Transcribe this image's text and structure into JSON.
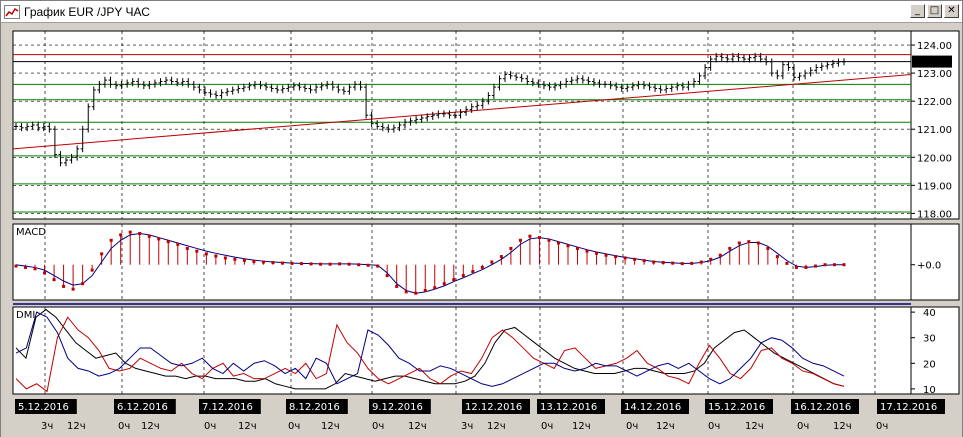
{
  "window": {
    "title": "График EUR /JPY  ЧАС",
    "buttons": [
      "_",
      "□",
      "✕"
    ]
  },
  "chart_data": [
    {
      "panel": "price",
      "type": "bar",
      "symbol": "EUR/JPY",
      "timeframe": "ЧАС",
      "current_price": "123.41",
      "y_ticks": [
        "124.00",
        "123.00",
        "122.00",
        "121.00",
        "120.00",
        "119.00",
        "118.00"
      ],
      "y_values": [
        124,
        123,
        122,
        121,
        120,
        119,
        118
      ],
      "ylim": [
        117.8,
        124.5
      ],
      "horizontal_levels": [
        {
          "value": 123.66,
          "color": "#c00000"
        },
        {
          "value": 123.41,
          "color": "#000000"
        },
        {
          "value": 122.6,
          "color": "#008000"
        },
        {
          "value": 122.05,
          "color": "#008000"
        },
        {
          "value": 121.25,
          "color": "#008000"
        },
        {
          "value": 120.05,
          "color": "#008000"
        },
        {
          "value": 119.05,
          "color": "#008000"
        },
        {
          "value": 118.05,
          "color": "#008000"
        }
      ],
      "trendline": {
        "from": [
          0,
          120.3
        ],
        "to": [
          1,
          122.95
        ],
        "color": "#c00000"
      },
      "closes": [
        121.1,
        121.05,
        121.1,
        121.15,
        121.05,
        121.1,
        121.0,
        120.1,
        119.8,
        119.9,
        120.0,
        120.3,
        121.0,
        121.8,
        122.4,
        122.6,
        122.75,
        122.6,
        122.55,
        122.6,
        122.65,
        122.7,
        122.6,
        122.55,
        122.6,
        122.65,
        122.7,
        122.75,
        122.7,
        122.65,
        122.7,
        122.6,
        122.5,
        122.4,
        122.3,
        122.25,
        122.2,
        122.3,
        122.35,
        122.4,
        122.45,
        122.5,
        122.55,
        122.6,
        122.55,
        122.5,
        122.45,
        122.4,
        122.45,
        122.5,
        122.55,
        122.5,
        122.45,
        122.4,
        122.5,
        122.55,
        122.6,
        122.5,
        122.4,
        122.35,
        122.5,
        122.6,
        122.5,
        121.5,
        121.2,
        121.1,
        121.05,
        121.0,
        121.05,
        121.15,
        121.25,
        121.3,
        121.35,
        121.4,
        121.45,
        121.5,
        121.55,
        121.55,
        121.5,
        121.5,
        121.6,
        121.7,
        121.8,
        121.85,
        122.0,
        122.2,
        122.5,
        122.8,
        122.95,
        122.9,
        122.85,
        122.8,
        122.7,
        122.65,
        122.6,
        122.55,
        122.5,
        122.55,
        122.6,
        122.7,
        122.75,
        122.8,
        122.75,
        122.7,
        122.65,
        122.6,
        122.6,
        122.55,
        122.5,
        122.45,
        122.5,
        122.55,
        122.6,
        122.55,
        122.5,
        122.45,
        122.4,
        122.45,
        122.5,
        122.55,
        122.5,
        122.6,
        122.7,
        122.9,
        123.2,
        123.5,
        123.6,
        123.55,
        123.5,
        123.6,
        123.55,
        123.5,
        123.55,
        123.6,
        123.5,
        123.4,
        123.0,
        122.9,
        123.3,
        123.2,
        122.85,
        122.9,
        123.0,
        123.1,
        123.2,
        123.25,
        123.3,
        123.35,
        123.4,
        123.41
      ]
    },
    {
      "panel": "MACD",
      "type": "line",
      "label": "MACD",
      "y_tick": "+0.0",
      "series": [
        {
          "name": "MACD",
          "color": "#c00000",
          "style": "histogram+dots"
        },
        {
          "name": "signal",
          "color": "#000080",
          "style": "line"
        }
      ],
      "macd": [
        -0.05,
        -0.1,
        -0.15,
        -0.3,
        -0.55,
        -0.8,
        -0.9,
        -0.7,
        -0.2,
        0.4,
        0.9,
        1.1,
        1.2,
        1.15,
        1.05,
        0.95,
        0.85,
        0.75,
        0.6,
        0.5,
        0.4,
        0.32,
        0.25,
        0.2,
        0.16,
        0.12,
        0.1,
        0.08,
        0.06,
        0.05,
        0.04,
        0.03,
        0.02,
        0.02,
        0.03,
        0.02,
        0.0,
        -0.02,
        -0.05,
        -0.4,
        -0.8,
        -1.0,
        -1.05,
        -0.95,
        -0.85,
        -0.7,
        -0.55,
        -0.4,
        -0.25,
        -0.1,
        0.1,
        0.3,
        0.6,
        0.9,
        1.05,
        1.0,
        0.9,
        0.8,
        0.7,
        0.6,
        0.5,
        0.42,
        0.35,
        0.3,
        0.25,
        0.2,
        0.15,
        0.1,
        0.08,
        0.06,
        0.04,
        0.05,
        0.1,
        0.2,
        0.35,
        0.6,
        0.8,
        0.85,
        0.8,
        0.6,
        0.3,
        0.05,
        -0.1,
        -0.1,
        -0.05,
        0.0,
        0.0,
        0.0
      ],
      "signal": [
        0.0,
        -0.05,
        -0.1,
        -0.2,
        -0.4,
        -0.6,
        -0.75,
        -0.7,
        -0.4,
        0.1,
        0.6,
        0.9,
        1.1,
        1.15,
        1.1,
        1.0,
        0.9,
        0.8,
        0.7,
        0.6,
        0.5,
        0.42,
        0.35,
        0.28,
        0.22,
        0.17,
        0.13,
        0.1,
        0.08,
        0.06,
        0.05,
        0.04,
        0.03,
        0.03,
        0.03,
        0.03,
        0.02,
        0.0,
        -0.02,
        -0.3,
        -0.7,
        -0.95,
        -1.05,
        -1.0,
        -0.9,
        -0.78,
        -0.62,
        -0.48,
        -0.33,
        -0.18,
        0.0,
        0.2,
        0.45,
        0.75,
        0.95,
        1.0,
        0.95,
        0.85,
        0.75,
        0.65,
        0.55,
        0.47,
        0.4,
        0.33,
        0.27,
        0.22,
        0.17,
        0.12,
        0.09,
        0.07,
        0.05,
        0.05,
        0.08,
        0.15,
        0.28,
        0.5,
        0.7,
        0.82,
        0.82,
        0.68,
        0.42,
        0.15,
        -0.05,
        -0.1,
        -0.07,
        -0.02,
        0.0,
        0.0
      ],
      "ylim": [
        -1.3,
        1.5
      ]
    },
    {
      "panel": "DMI",
      "type": "line",
      "label": "DMI",
      "y_ticks": [
        "40",
        "30",
        "20",
        "10"
      ],
      "y_values": [
        40,
        30,
        20,
        10
      ],
      "ylim": [
        8,
        42
      ],
      "series": [
        {
          "name": "ADX",
          "color": "#000000",
          "values": [
            26,
            22,
            38,
            41,
            38,
            33,
            28,
            25,
            22,
            23,
            24,
            20,
            18,
            17,
            16,
            15,
            15,
            14,
            15,
            15,
            14,
            14,
            14,
            13,
            13,
            14,
            12,
            11,
            10,
            10,
            10,
            10,
            12,
            16,
            15,
            14,
            13,
            14,
            15,
            15,
            14,
            13,
            12,
            12,
            12,
            13,
            15,
            20,
            28,
            33,
            34,
            31,
            28,
            25,
            22,
            20,
            18,
            17,
            16,
            16,
            16,
            17,
            18,
            18,
            17,
            16,
            16,
            16,
            17,
            20,
            26,
            29,
            32,
            33,
            30,
            27,
            24,
            22,
            20,
            18,
            16,
            14,
            12,
            11
          ]
        },
        {
          "name": "+DI",
          "color": "#c00000",
          "values": [
            14,
            10,
            12,
            9,
            30,
            38,
            33,
            30,
            25,
            18,
            17,
            18,
            22,
            20,
            18,
            17,
            20,
            16,
            14,
            18,
            20,
            15,
            16,
            14,
            14,
            16,
            18,
            16,
            20,
            14,
            16,
            35,
            28,
            24,
            18,
            14,
            12,
            14,
            16,
            18,
            14,
            12,
            15,
            17,
            16,
            22,
            30,
            33,
            30,
            26,
            22,
            20,
            18,
            25,
            26,
            22,
            18,
            19,
            20,
            22,
            25,
            20,
            18,
            15,
            14,
            12,
            20,
            27,
            22,
            16,
            14,
            18,
            25,
            26,
            22,
            20,
            17,
            16,
            14,
            12,
            11
          ]
        },
        {
          "name": "-DI",
          "color": "#000080",
          "values": [
            24,
            26,
            40,
            38,
            32,
            22,
            18,
            17,
            15,
            16,
            18,
            22,
            26,
            26,
            23,
            20,
            19,
            20,
            22,
            18,
            16,
            20,
            17,
            20,
            21,
            19,
            16,
            18,
            14,
            22,
            20,
            12,
            14,
            16,
            33,
            31,
            27,
            22,
            20,
            17,
            17,
            19,
            18,
            16,
            14,
            12,
            11,
            12,
            14,
            16,
            18,
            20,
            20,
            18,
            17,
            18,
            20,
            19,
            19,
            17,
            15,
            17,
            19,
            20,
            18,
            20,
            17,
            14,
            12,
            14,
            18,
            22,
            28,
            30,
            29,
            26,
            22,
            20,
            19,
            17,
            15
          ]
        }
      ]
    }
  ],
  "x_axis": {
    "dates": [
      "5.12.2016",
      "6.12.2016",
      "7.12.2016",
      "8.12.2016",
      "9.12.2016",
      "12.12.2016",
      "13.12.2016",
      "14.12.2016",
      "15.12.2016",
      "16.12.2016",
      "17.12.2016"
    ],
    "hours": [
      "3ч",
      "12ч",
      "0ч",
      "12ч",
      "0ч",
      "12ч",
      "0ч",
      "12ч",
      "0ч",
      "12ч",
      "3ч",
      "12ч",
      "0ч",
      "12ч",
      "0ч",
      "12ч",
      "0ч",
      "12ч",
      "0ч",
      "12ч",
      "0ч"
    ]
  }
}
